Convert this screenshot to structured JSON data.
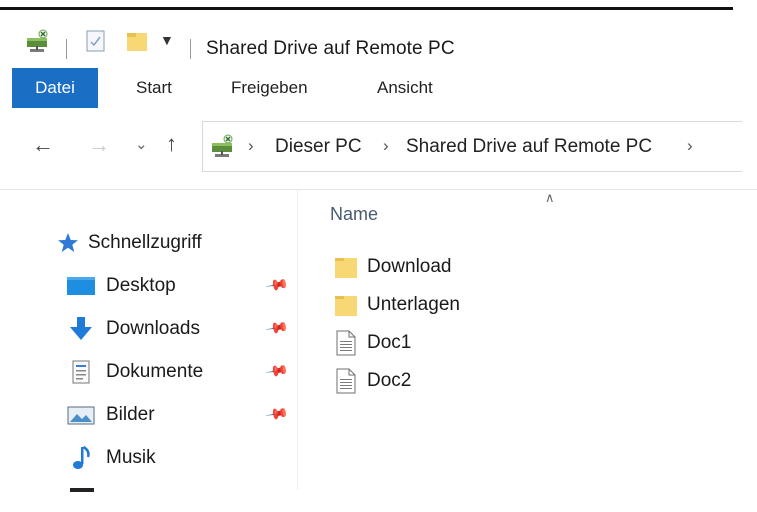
{
  "window": {
    "title": "Shared Drive auf Remote PC"
  },
  "ribbon": {
    "tabs": [
      "Datei",
      "Start",
      "Freigeben",
      "Ansicht"
    ],
    "active_tab": "Datei",
    "accent_color": "#1a6fc4"
  },
  "address_bar": {
    "crumbs": [
      "Dieser PC",
      "Shared Drive auf Remote PC"
    ],
    "nav_icons": [
      "back-arrow-icon",
      "forward-arrow-icon",
      "recent-dropdown-icon",
      "up-arrow-icon"
    ]
  },
  "nav_pane": {
    "quick_access": "Schnellzugriff",
    "items": [
      {
        "label": "Desktop",
        "icon": "desktop-icon",
        "pinned": true
      },
      {
        "label": "Downloads",
        "icon": "downloads-icon",
        "pinned": true
      },
      {
        "label": "Dokumente",
        "icon": "documents-icon",
        "pinned": true
      },
      {
        "label": "Bilder",
        "icon": "pictures-icon",
        "pinned": true
      },
      {
        "label": "Musik",
        "icon": "music-icon",
        "pinned": false
      }
    ]
  },
  "file_list": {
    "column_header": "Name",
    "files": [
      {
        "name": "Download",
        "type": "folder"
      },
      {
        "name": "Unterlagen",
        "type": "folder"
      },
      {
        "name": "Doc1",
        "type": "document"
      },
      {
        "name": "Doc2",
        "type": "document"
      }
    ]
  }
}
